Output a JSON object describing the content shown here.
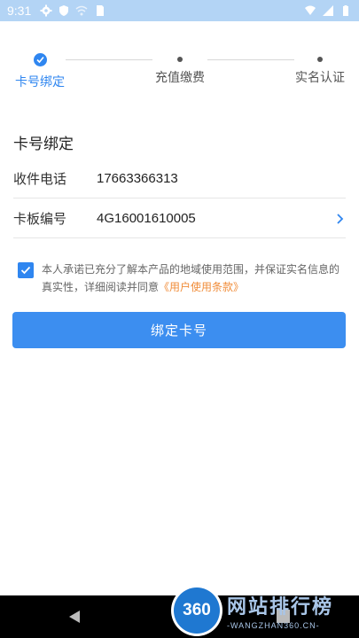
{
  "status_bar": {
    "time": "9:31"
  },
  "steps": [
    {
      "label": "卡号绑定",
      "state": "done"
    },
    {
      "label": "充值缴费",
      "state": "pending"
    },
    {
      "label": "实名认证",
      "state": "pending"
    }
  ],
  "section_title": "卡号绑定",
  "fields": {
    "phone": {
      "label": "收件电话",
      "value": "17663366313"
    },
    "board": {
      "label": "卡板编号",
      "value": "4G16001610005"
    }
  },
  "agreement": {
    "checked": true,
    "text": "本人承诺已充分了解本产品的地域使用范围，并保证实名信息的真实性，详细阅读并同意",
    "link": "《用户使用条款》"
  },
  "bind_button": "绑定卡号",
  "watermark": {
    "logo": "360",
    "title": "网站排行榜",
    "subtitle": "-WANGZHAN360.CN-"
  },
  "colors": {
    "accent": "#2f86f0",
    "link": "#f08c39",
    "status_bar": "#b3d4f5"
  }
}
